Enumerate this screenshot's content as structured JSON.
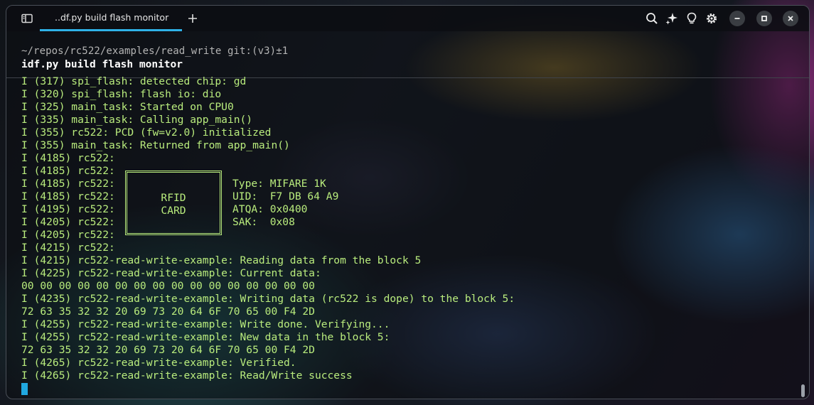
{
  "window": {
    "tab_title": "..df.py build flash monitor"
  },
  "icons": {
    "sidebar": "sidebar-toggle-icon",
    "new_tab": "plus-icon",
    "search": "search-icon",
    "ai": "sparkle-icon",
    "tips": "lightbulb-icon",
    "settings": "gear-icon",
    "minimize": "minimize-icon",
    "maximize": "maximize-icon",
    "close": "close-icon"
  },
  "colors": {
    "output_text": "#b9ec7d",
    "accent": "#2fb2e8"
  },
  "terminal": {
    "prompt": "~/repos/rc522/examples/read_write git:(v3)±1",
    "command": "idf.py build flash monitor",
    "lines": [
      "I (317) spi_flash: detected chip: gd",
      "I (320) spi_flash: flash io: dio",
      "I (325) main_task: Started on CPU0",
      "I (335) main_task: Calling app_main()",
      "I (355) rc522: PCD (fw=v2.0) initialized",
      "I (355) main_task: Returned from app_main()",
      "I (4185) rc522:",
      "I (4185) rc522:",
      "I (4185) rc522:",
      "I (4185) rc522:",
      "I (4195) rc522:",
      "I (4205) rc522:",
      "I (4205) rc522:",
      "I (4215) rc522:",
      "I (4215) rc522-read-write-example: Reading data from the block 5",
      "I (4225) rc522-read-write-example: Current data:",
      "00 00 00 00 00 00 00 00 00 00 00 00 00 00 00 00",
      "I (4235) rc522-read-write-example: Writing data (rc522 is dope) to the block 5:",
      "72 63 35 32 32 20 69 73 20 64 6F 70 65 00 F4 2D",
      "I (4255) rc522-read-write-example: Write done. Verifying...",
      "I (4255) rc522-read-write-example: New data in the block 5:",
      "72 63 35 32 32 20 69 73 20 64 6F 70 65 00 F4 2D",
      "I (4265) rc522-read-write-example: Verified.",
      "I (4265) rc522-read-write-example: Read/Write success"
    ],
    "card": {
      "line1": "RFID",
      "line2": "CARD"
    },
    "card_info": [
      "Type: MIFARE 1K",
      "UID:  F7 DB 64 A9",
      "ATQA: 0x0400",
      "SAK:  0x08"
    ]
  }
}
